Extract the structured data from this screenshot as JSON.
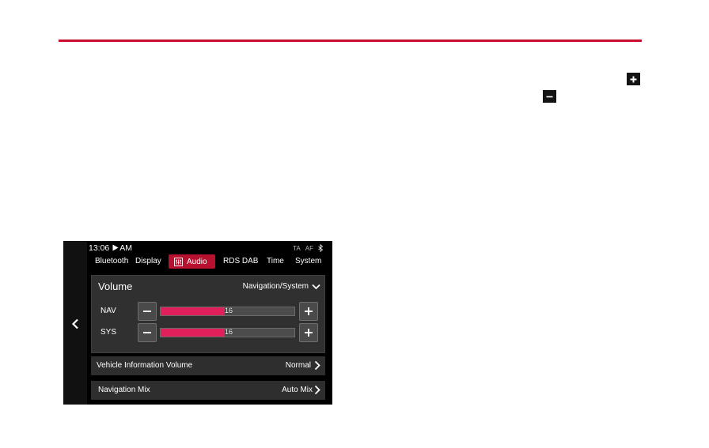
{
  "head_unit": {
    "status": {
      "time": "13:06",
      "am_pm": "AM",
      "ta": "TA",
      "af": "AF"
    },
    "tabs": [
      "Bluetooth",
      "Display",
      "Audio",
      "RDS DAB",
      "Time",
      "System"
    ],
    "active_tab": "Audio",
    "volume_panel": {
      "title": "Volume",
      "mode": "Navigation/System",
      "rows": [
        {
          "label": "NAV",
          "value": "16",
          "fraction": 0.48
        },
        {
          "label": "SYS",
          "value": "16",
          "fraction": 0.48
        }
      ]
    },
    "vehicle_info_volume": {
      "label": "Vehicle Information Volume",
      "value": "Normal"
    },
    "navigation_mix": {
      "label": "Navigation Mix",
      "value": "Auto Mix"
    }
  },
  "colors": {
    "accent_red": "#c8102e",
    "bar_fill": "#e0205a",
    "tab_active": "#b8102f"
  },
  "icons": [
    "plus-icon",
    "minus-icon",
    "chevron-left-icon",
    "chevron-down-icon",
    "chevron-right-icon",
    "bluetooth-icon",
    "play-icon",
    "equalizer-icon"
  ]
}
